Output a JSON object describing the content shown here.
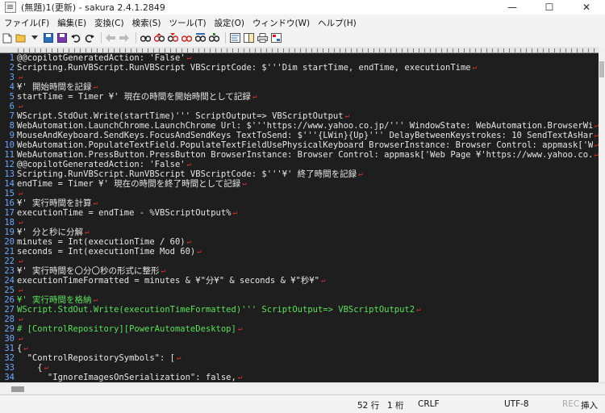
{
  "window": {
    "title": "(無題)1(更新) - sakura 2.4.1.2849",
    "minimize": "—",
    "maximize": "☐",
    "close": "✕"
  },
  "menu": [
    "ファイル(F)",
    "編集(E)",
    "変換(C)",
    "検索(S)",
    "ツール(T)",
    "設定(O)",
    "ウィンドウ(W)",
    "ヘルプ(H)"
  ],
  "toolbar_icons": [
    "new-file-icon",
    "open-file-icon",
    "dropdown-icon",
    "save-icon",
    "save-all-icon",
    "undo-icon",
    "redo-icon",
    "jump-back-icon",
    "jump-forward-icon",
    "search-icon",
    "search-prev-icon",
    "search-next-icon",
    "search-bar-icon",
    "grep-icon",
    "tag-jump-icon",
    "outline-icon",
    "compare-icon",
    "print-icon",
    "settings-icon",
    "bookmark-icon"
  ],
  "lines": [
    {
      "n": "1",
      "t": "@@copilotGeneratedAction: 'False'",
      "g": false
    },
    {
      "n": "2",
      "t": "Scripting.RunVBScript.RunVBScript VBScriptCode: $'''Dim startTime, endTime, executionTime",
      "g": false
    },
    {
      "n": "3",
      "t": "",
      "g": false
    },
    {
      "n": "4",
      "t": "¥' 開始時間を記録",
      "g": false
    },
    {
      "n": "5",
      "t": "startTime = Timer ¥' 現在の時間を開始時間として記録",
      "g": false
    },
    {
      "n": "6",
      "t": "",
      "g": false
    },
    {
      "n": "7",
      "t": "WScript.StdOut.Write(startTime)''' ScriptOutput=> VBScriptOutput",
      "g": false
    },
    {
      "n": "8",
      "t": "WebAutomation.LaunchChrome.LaunchChrome Url: $'''https://www.yahoo.co.jp/''' WindowState: WebAutomation.BrowserWindowSta",
      "g": false
    },
    {
      "n": "9",
      "t": "MouseAndKeyboard.SendKeys.FocusAndSendKeys TextToSend: $'''{LWin}{Up}''' DelayBetweenKeystrokes: 10 SendTextAsHardwareKe",
      "g": false
    },
    {
      "n": "10",
      "t": "WebAutomation.PopulateTextField.PopulateTextFieldUsePhysicalKeyboard BrowserInstance: Browser Control: appmask['Web Page",
      "g": false
    },
    {
      "n": "11",
      "t": "WebAutomation.PressButton.PressButton BrowserInstance: Browser Control: appmask['Web Page ¥'https://www.yahoo.co.jp/¥'']",
      "g": false
    },
    {
      "n": "12",
      "t": "@@copilotGeneratedAction: 'False'",
      "g": false
    },
    {
      "n": "13",
      "t": "Scripting.RunVBScript.RunVBScript VBScriptCode: $'''¥' 終了時間を記録",
      "g": false
    },
    {
      "n": "14",
      "t": "endTime = Timer ¥' 現在の時間を終了時間として記録",
      "g": false
    },
    {
      "n": "15",
      "t": "",
      "g": false
    },
    {
      "n": "16",
      "t": "¥' 実行時間を計算",
      "g": false
    },
    {
      "n": "17",
      "t": "executionTime = endTime - %VBScriptOutput%",
      "g": false
    },
    {
      "n": "18",
      "t": "",
      "g": false
    },
    {
      "n": "19",
      "t": "¥' 分と秒に分解",
      "g": false
    },
    {
      "n": "20",
      "t": "minutes = Int(executionTime / 60)",
      "g": false
    },
    {
      "n": "21",
      "t": "seconds = Int(executionTime Mod 60)",
      "g": false
    },
    {
      "n": "22",
      "t": "",
      "g": false
    },
    {
      "n": "23",
      "t": "¥' 実行時間を〇分〇秒の形式に整形",
      "g": false
    },
    {
      "n": "24",
      "t": "executionTimeFormatted = minutes & ¥\"分¥\" & seconds & ¥\"秒¥\"",
      "g": false
    },
    {
      "n": "25",
      "t": "",
      "g": false
    },
    {
      "n": "26",
      "t": "¥' 実行時間を格納",
      "g": true
    },
    {
      "n": "27",
      "t": "WScript.StdOut.Write(executionTimeFormatted)''' ScriptOutput=> VBScriptOutput2",
      "g": true
    },
    {
      "n": "28",
      "t": "",
      "g": true
    },
    {
      "n": "29",
      "t": "# [ControlRepository][PowerAutomateDesktop]",
      "g": true
    },
    {
      "n": "30",
      "t": "",
      "g": false
    },
    {
      "n": "31",
      "t": "{",
      "g": false
    },
    {
      "n": "32",
      "t": "  \"ControlRepositorySymbols\": [",
      "g": false
    },
    {
      "n": "33",
      "t": "    {",
      "g": false
    },
    {
      "n": "34",
      "t": "      \"IgnoreImagesOnSerialization\": false,",
      "g": false
    }
  ],
  "status": {
    "line": "52 行",
    "col": "1 桁",
    "eol": "CRLF",
    "encoding": "UTF-8",
    "rec": "REC",
    "insert": "挿入"
  }
}
